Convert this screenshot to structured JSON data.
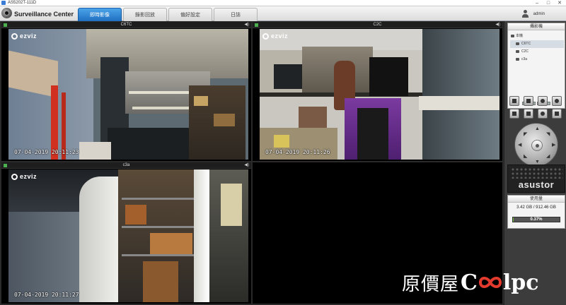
{
  "window": {
    "title": "AS5202T-111D"
  },
  "header": {
    "app_title": "Surveillance Center",
    "tabs": [
      "即時影像",
      "錄影回放",
      "偏好設定",
      "日誌"
    ],
    "user": "admin"
  },
  "cameras": [
    {
      "name": "C6TC",
      "brand": "ezviz",
      "timestamp": "07-04-2019 20:11:23"
    },
    {
      "name": "C2C",
      "brand": "ezviz",
      "timestamp": "07-04-2019 20:11:26"
    },
    {
      "name": "c3a",
      "brand": "ezviz",
      "timestamp": "07-04-2019 20:11:27"
    }
  ],
  "sidebar": {
    "camera_list": {
      "title": "攝影機",
      "root": "本機",
      "items": [
        "C6TC",
        "C2C",
        "c3a"
      ]
    },
    "tools": [
      "layout-grid-icon",
      "layout-single-icon",
      "snapshot-icon",
      "record-icon",
      "fullscreen-icon",
      "audio-icon",
      "settings-icon",
      "wrench-icon"
    ],
    "brand": "asustor",
    "usage": {
      "title": "使用量",
      "size": "3.42 GB / 912.46 GB",
      "percent": "0.37%",
      "fraction": 0.0037
    }
  },
  "watermark": {
    "cjk": "原價屋",
    "c": "C",
    "latin": "lpc"
  },
  "colors": {
    "tab_active": "#1f6fc0",
    "usage_fill": "#6fbf3a",
    "online_dot": "#4caf50"
  }
}
